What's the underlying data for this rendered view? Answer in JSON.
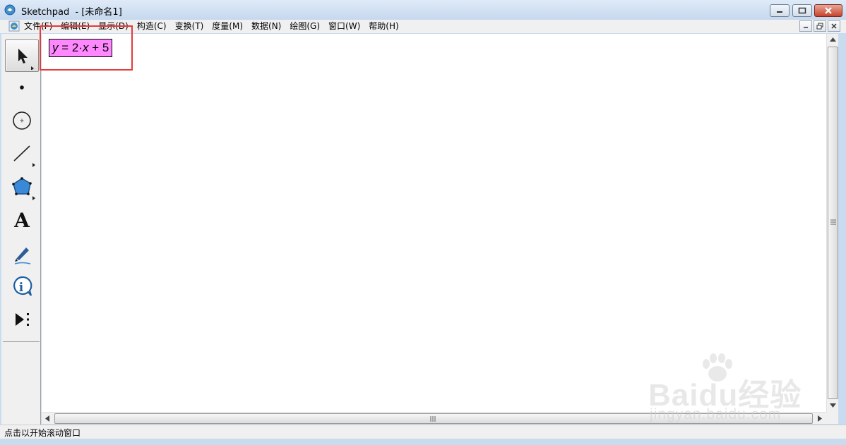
{
  "window": {
    "title": "Sketchpad  - [未命名1]"
  },
  "menu": {
    "items": [
      "文件(F)",
      "编辑(E)",
      "显示(D)",
      "构造(C)",
      "变换(T)",
      "度量(M)",
      "数据(N)",
      "绘图(G)",
      "窗口(W)",
      "帮助(H)"
    ]
  },
  "toolbox": {
    "tools": [
      "arrow-select-tool",
      "point-tool",
      "compass-tool",
      "straightedge-tool",
      "polygon-tool",
      "text-tool",
      "marker-tool",
      "information-tool",
      "custom-tools"
    ],
    "selected": "arrow-select-tool"
  },
  "canvas": {
    "function_label": {
      "var": "y",
      "eq": " = 2·",
      "x": "x",
      "rest": " + 5"
    },
    "label_bg": "#ff88ff",
    "highlight_border": "#e43a3a"
  },
  "status": {
    "text": "点击以开始滚动窗口"
  },
  "watermark": {
    "logo": "Baidu经验",
    "url": "jingyan.baidu.com"
  }
}
